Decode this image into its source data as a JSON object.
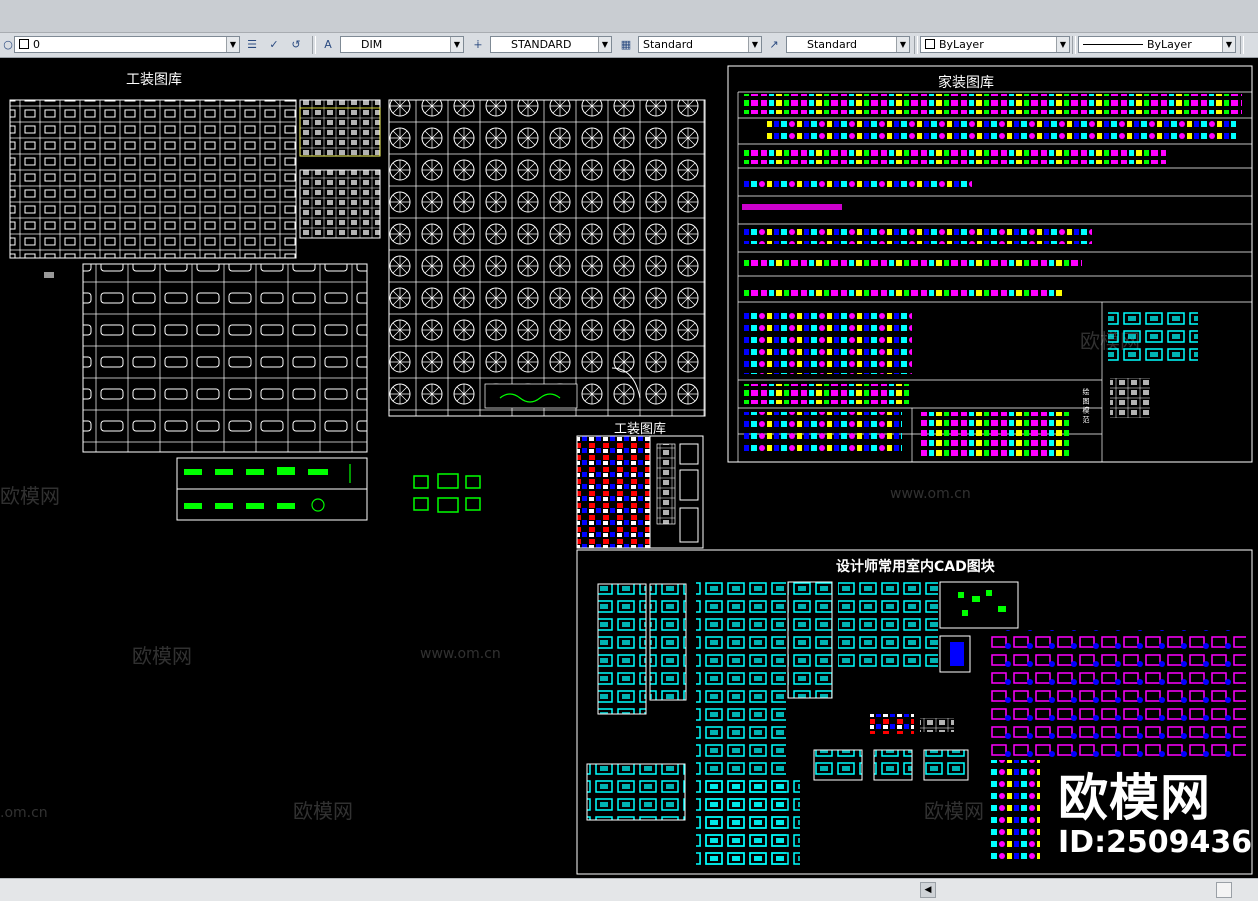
{
  "toolbar": {
    "layer_value": "0",
    "dimstyle_value": "DIM",
    "textstyle_value": "STANDARD",
    "tablestyle_value": "Standard",
    "mleaderstyle_value": "Standard",
    "color_value": "ByLayer",
    "linetype_value": "ByLayer"
  },
  "drawing": {
    "title_gongzhuang_1": "工装图库",
    "title_jiazhuang": "家装图库",
    "title_gongzhuang_2": "工装图库",
    "title_designer": "设计师常用室内CAD图块",
    "jiazhuang_side_label": "绘 图 模 范"
  },
  "watermarks": {
    "brand": "欧模网",
    "url": "www.om.cn",
    "url_short": ".om.cn",
    "corner_name": "欧模网",
    "corner_id": "ID:2509436"
  },
  "colors": {
    "cyan": "#00ffff",
    "magenta": "#ff00ff",
    "green": "#00ff00",
    "yellow": "#ffff00",
    "red": "#ff0000",
    "blue": "#0000ff",
    "white": "#ffffff"
  }
}
